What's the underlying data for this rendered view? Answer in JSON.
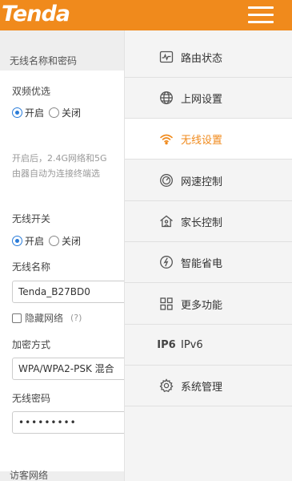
{
  "header": {
    "logo": "Tenda"
  },
  "wireless": {
    "section_title": "无线名称和密码",
    "dual_band_label": "双频优选",
    "on_label": "开启",
    "off_label": "关闭",
    "dual_band_hint_1": "开启后，2.4G网络和5G",
    "dual_band_hint_2": "由器自动为连接终端选",
    "switch_label": "无线开关",
    "ssid_label": "无线名称",
    "ssid_value": "Tenda_B27BD0",
    "hide_label": "隐藏网络",
    "hide_help": "(?)",
    "encryption_label": "加密方式",
    "encryption_value": "WPA/WPA2-PSK 混合",
    "password_label": "无线密码",
    "password_value": "•••••••••",
    "guest_title": "访客网络"
  },
  "menu": {
    "items": [
      {
        "label": "路由状态",
        "icon": "status-icon"
      },
      {
        "label": "上网设置",
        "icon": "globe-icon"
      },
      {
        "label": "无线设置",
        "icon": "wifi-icon"
      },
      {
        "label": "网速控制",
        "icon": "speed-icon"
      },
      {
        "label": "家长控制",
        "icon": "home-icon"
      },
      {
        "label": "智能省电",
        "icon": "power-icon"
      },
      {
        "label": "更多功能",
        "icon": "grid-icon"
      },
      {
        "label": "IPv6",
        "icon": "ipv6-icon",
        "icon_text": "IP6"
      },
      {
        "label": "系统管理",
        "icon": "gear-icon"
      }
    ]
  },
  "colors": {
    "brand": "#f08a1c",
    "radio_on": "#2a7cd9"
  }
}
